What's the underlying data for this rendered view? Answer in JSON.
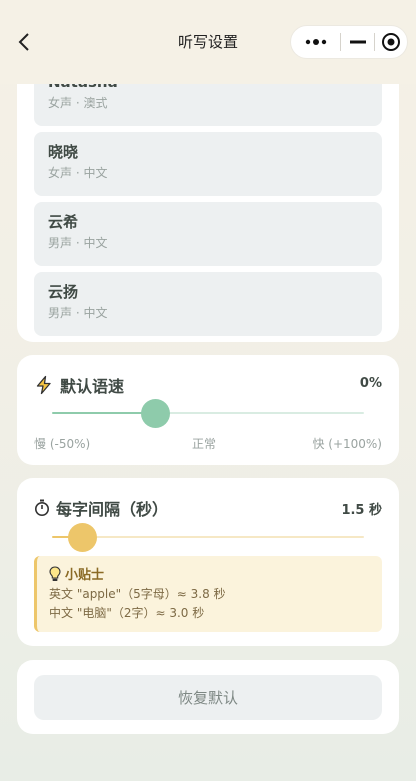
{
  "header": {
    "title": "听写设置"
  },
  "voices": [
    {
      "name": "Natasha",
      "desc": "女声 · 澳式"
    },
    {
      "name": "晓晓",
      "desc": "女声 · 中文"
    },
    {
      "name": "云希",
      "desc": "男声 · 中文"
    },
    {
      "name": "云扬",
      "desc": "男声 · 中文"
    }
  ],
  "speed": {
    "title": "默认语速",
    "value_text": "0%",
    "value": 0,
    "min_label": "慢 (-50%)",
    "mid_label": "正常",
    "max_label": "快 (+100%)",
    "icon": "lightning-icon",
    "accent": "#8ecbab"
  },
  "interval": {
    "title": "每字间隔（秒）",
    "value_text": "1.5 秒",
    "icon": "stopwatch-icon",
    "accent": "#edc66a",
    "tip": {
      "title": "小贴士",
      "icon": "lightbulb-icon",
      "lines": [
        "英文 \"apple\"（5字母）≈ 3.8 秒",
        "中文 \"电脑\"（2字）≈ 3.0 秒"
      ]
    }
  },
  "reset": {
    "label": "恢复默认"
  }
}
